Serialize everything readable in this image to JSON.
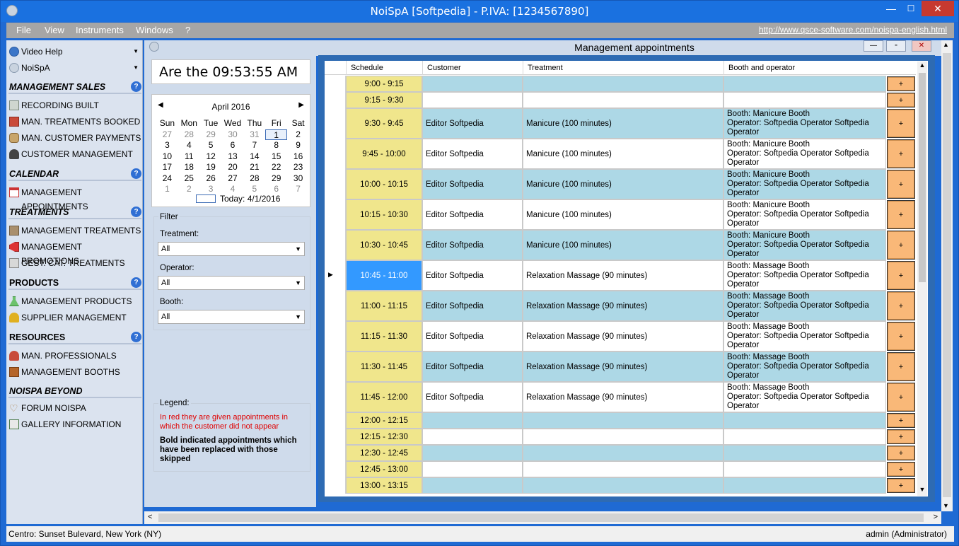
{
  "window": {
    "title": "NoiSpA  [Softpedia] - P.IVA: [1234567890]",
    "btn_min": "—",
    "btn_max": "☐",
    "btn_close": "✕"
  },
  "menu": {
    "items": [
      "File",
      "View",
      "Instruments",
      "Windows",
      "?"
    ],
    "url": "http://www.qsce-software.com/noispa-english.html"
  },
  "sidebar": {
    "video_help": "Video Help",
    "noispa": "NoiSpA",
    "sections": {
      "sales": "MANAGEMENT SALES",
      "calendar": "CALENDAR",
      "treatments": "TREATMENTS",
      "products": "PRODUCTS",
      "resources": "RESOURCES",
      "beyond": "NOISPA BEYOND"
    },
    "help": "?",
    "items": {
      "recording": "RECORDING BUILT",
      "treat_booked": "MAN. TREATMENTS BOOKED",
      "cust_pay": "MAN. CUSTOMER PAYMENTS",
      "cust_mgmt": "CUSTOMER MANAGEMENT",
      "appts": "MANAGEMENT APPOINTMENTS",
      "mgmt_treat": "MANAGEMENT TREATMENTS",
      "mgmt_promo": "MANAGEMENT PROMOTIONS",
      "cat_treat": "GEST. CAT. TREATMENTS",
      "mgmt_prod": "MANAGEMENT PRODUCTS",
      "supplier": "SUPPLIER MANAGEMENT",
      "professionals": "MAN. PROFESSIONALS",
      "booths": "MANAGEMENT BOOTHS",
      "forum": "FORUM NOISPA",
      "gallery": "GALLERY INFORMATION"
    }
  },
  "clock": {
    "text": "Are the 09:53:55 AM"
  },
  "calendar": {
    "month": "April 2016",
    "prev": "◀",
    "next": "▶",
    "weekdays": [
      "Sun",
      "Mon",
      "Tue",
      "Wed",
      "Thu",
      "Fri",
      "Sat"
    ],
    "weeks": [
      [
        "27",
        "28",
        "29",
        "30",
        "31",
        "1",
        "2"
      ],
      [
        "3",
        "4",
        "5",
        "6",
        "7",
        "8",
        "9"
      ],
      [
        "10",
        "11",
        "12",
        "13",
        "14",
        "15",
        "16"
      ],
      [
        "17",
        "18",
        "19",
        "20",
        "21",
        "22",
        "23"
      ],
      [
        "24",
        "25",
        "26",
        "27",
        "28",
        "29",
        "30"
      ],
      [
        "1",
        "2",
        "3",
        "4",
        "5",
        "6",
        "7"
      ]
    ],
    "today": "Today: 4/1/2016"
  },
  "filter": {
    "legend": "Filter",
    "treatment_label": "Treatment:",
    "treatment_value": "All",
    "operator_label": "Operator:",
    "operator_value": "All",
    "booth_label": "Booth:",
    "booth_value": "All"
  },
  "legend": {
    "title": "Legend:",
    "red_text": "In red they are given appointments in which the customer did not appear",
    "bold_text": "Bold indicated appointments which have been replaced with those skipped"
  },
  "appointments": {
    "title": "Management appointments",
    "columns": {
      "schedule": "Schedule",
      "customer": "Customer",
      "treatment": "Treatment",
      "booth": "Booth and operator"
    },
    "add": "+",
    "rows": [
      {
        "time": "9:00 - 9:15",
        "customer": "",
        "treatment": "",
        "booth": [
          "",
          "",
          ""
        ]
      },
      {
        "time": "9:15 - 9:30",
        "customer": "",
        "treatment": "",
        "booth": [
          "",
          "",
          ""
        ]
      },
      {
        "time": "9:30 - 9:45",
        "customer": "Editor Softpedia",
        "treatment": "Manicure (100 minutes)",
        "booth": [
          "Booth: Manicure Booth",
          "Operator: Softpedia Operator Softpedia",
          "Operator"
        ]
      },
      {
        "time": "9:45 - 10:00",
        "customer": "Editor Softpedia",
        "treatment": "Manicure (100 minutes)",
        "booth": [
          "Booth: Manicure Booth",
          "Operator: Softpedia Operator Softpedia",
          "Operator"
        ]
      },
      {
        "time": "10:00 - 10:15",
        "customer": "Editor Softpedia",
        "treatment": "Manicure (100 minutes)",
        "booth": [
          "Booth: Manicure Booth",
          "Operator: Softpedia Operator Softpedia",
          "Operator"
        ]
      },
      {
        "time": "10:15 - 10:30",
        "customer": "Editor Softpedia",
        "treatment": "Manicure (100 minutes)",
        "booth": [
          "Booth: Manicure Booth",
          "Operator: Softpedia Operator Softpedia",
          "Operator"
        ]
      },
      {
        "time": "10:30 - 10:45",
        "customer": "Editor Softpedia",
        "treatment": "Manicure (100 minutes)",
        "booth": [
          "Booth: Manicure Booth",
          "Operator: Softpedia Operator Softpedia",
          "Operator"
        ]
      },
      {
        "time": "10:45 - 11:00",
        "customer": "Editor Softpedia",
        "treatment": "Relaxation Massage (90 minutes)",
        "booth": [
          "Booth: Massage Booth",
          "Operator: Softpedia Operator Softpedia",
          "Operator"
        ]
      },
      {
        "time": "11:00 - 11:15",
        "customer": "Editor Softpedia",
        "treatment": "Relaxation Massage (90 minutes)",
        "booth": [
          "Booth: Massage Booth",
          "Operator: Softpedia Operator Softpedia",
          "Operator"
        ]
      },
      {
        "time": "11:15 - 11:30",
        "customer": "Editor Softpedia",
        "treatment": "Relaxation Massage (90 minutes)",
        "booth": [
          "Booth: Massage Booth",
          "Operator: Softpedia Operator Softpedia",
          "Operator"
        ]
      },
      {
        "time": "11:30 - 11:45",
        "customer": "Editor Softpedia",
        "treatment": "Relaxation Massage (90 minutes)",
        "booth": [
          "Booth: Massage Booth",
          "Operator: Softpedia Operator Softpedia",
          "Operator"
        ]
      },
      {
        "time": "11:45 - 12:00",
        "customer": "Editor Softpedia",
        "treatment": "Relaxation Massage (90 minutes)",
        "booth": [
          "Booth: Massage Booth",
          "Operator: Softpedia Operator Softpedia",
          "Operator"
        ]
      },
      {
        "time": "12:00 - 12:15",
        "customer": "",
        "treatment": "",
        "booth": [
          "",
          "",
          ""
        ]
      },
      {
        "time": "12:15 - 12:30",
        "customer": "",
        "treatment": "",
        "booth": [
          "",
          "",
          ""
        ]
      },
      {
        "time": "12:30 - 12:45",
        "customer": "",
        "treatment": "",
        "booth": [
          "",
          "",
          ""
        ]
      },
      {
        "time": "12:45 - 13:00",
        "customer": "",
        "treatment": "",
        "booth": [
          "",
          "",
          ""
        ]
      },
      {
        "time": "13:00 - 13:15",
        "customer": "",
        "treatment": "",
        "booth": [
          "",
          "",
          ""
        ]
      }
    ]
  },
  "colors": {
    "time_cell": "#f0e68c",
    "row_alt": "#add8e6",
    "selected": "#3399ff",
    "add_btn": "#f9b878"
  },
  "status": {
    "left": "Centro: Sunset Bulevard,  New York (NY)",
    "right": "admin (Administrator)"
  }
}
